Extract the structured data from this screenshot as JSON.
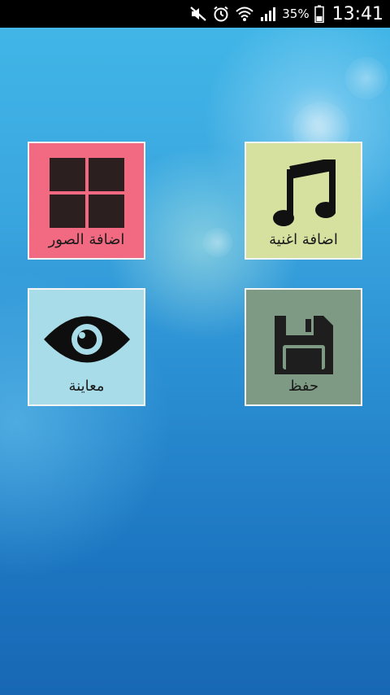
{
  "status_bar": {
    "icons": [
      "mute-icon",
      "alarm-icon",
      "wifi-icon",
      "signal-icon",
      "battery-icon"
    ],
    "battery_percent": "35%",
    "time": "13:41"
  },
  "tiles": {
    "add_photos": {
      "label": "اضافة الصور",
      "icon": "grid-icon",
      "color": "#f26a82"
    },
    "add_song": {
      "label": "اضافة اغنية",
      "icon": "music-note-icon",
      "color": "#d6e1a0"
    },
    "preview": {
      "label": "معاينة",
      "icon": "eye-icon",
      "color": "#a8dce8"
    },
    "save": {
      "label": "حفظ",
      "icon": "floppy-disk-icon",
      "color": "#7f9a84"
    }
  }
}
